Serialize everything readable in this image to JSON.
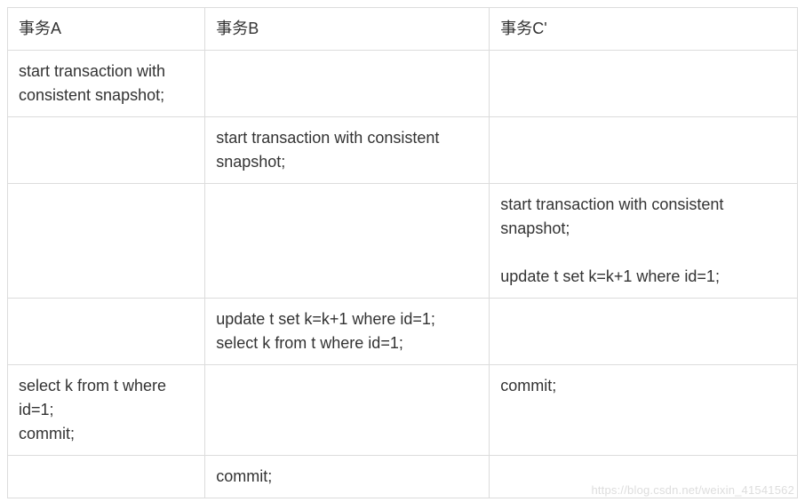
{
  "table": {
    "headers": [
      "事务A",
      "事务B",
      "事务C'"
    ],
    "rows": [
      {
        "a": "start transaction with consistent snapshot;",
        "b": "",
        "c": ""
      },
      {
        "a": "",
        "b": "start transaction with consistent snapshot;",
        "c": ""
      },
      {
        "a": "",
        "b": "",
        "c": "start transaction with consistent snapshot;\n\nupdate t set k=k+1 where id=1;"
      },
      {
        "a": "",
        "b": "update t set k=k+1 where id=1;\nselect k from t where id=1;",
        "c": ""
      },
      {
        "a": "select k from t where id=1;\ncommit;",
        "b": "",
        "c": "commit;"
      },
      {
        "a": "",
        "b": "commit;",
        "c": ""
      }
    ]
  },
  "watermark": "https://blog.csdn.net/weixin_41541562"
}
